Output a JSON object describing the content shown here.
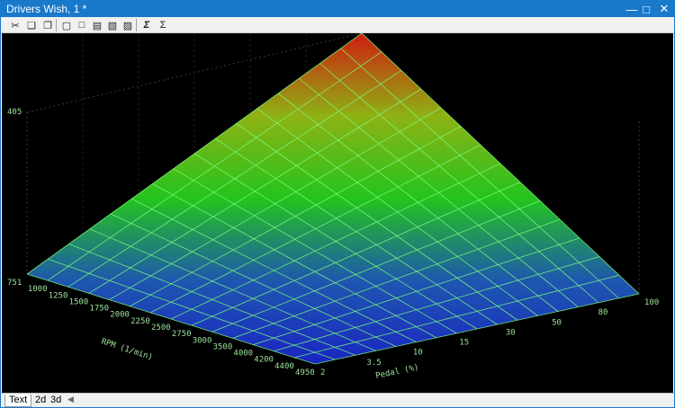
{
  "window": {
    "title": "Drivers Wish, 1 *"
  },
  "titlebar_buttons": {
    "minimize": "minimize-icon",
    "maximize": "maximize-icon",
    "close": "close-icon"
  },
  "toolbar": {
    "buttons": [
      "cut-icon",
      "copy-icon",
      "paste-icon",
      "add-row-icon",
      "insert-row-icon",
      "delete-row-icon",
      "delete-column-icon",
      "insert-column-icon",
      "sum-edit-icon",
      "sum-icon"
    ]
  },
  "tabs": [
    {
      "label": "Text",
      "active": true
    },
    {
      "label": "2d",
      "active": false
    },
    {
      "label": "3d",
      "active": false
    }
  ],
  "plot": {
    "z_label": "405",
    "x_axis_title": "RPM (1/min)",
    "y_axis_title": "Pedal (%)",
    "rpm_ticks": [
      "751",
      "1000",
      "1250",
      "1500",
      "1750",
      "2000",
      "2250",
      "2500",
      "2750",
      "3000",
      "3500",
      "4000",
      "4200",
      "4400",
      "4950"
    ],
    "pedal_ticks": [
      "2",
      "3.5",
      "10",
      "15",
      "30",
      "50",
      "80",
      "100"
    ],
    "colors": {
      "surface_low": "#1a2abf",
      "surface_mid": "#22c21c",
      "surface_high": "#c81a10",
      "grid": "#7cff7c",
      "background": "#000000"
    }
  }
}
